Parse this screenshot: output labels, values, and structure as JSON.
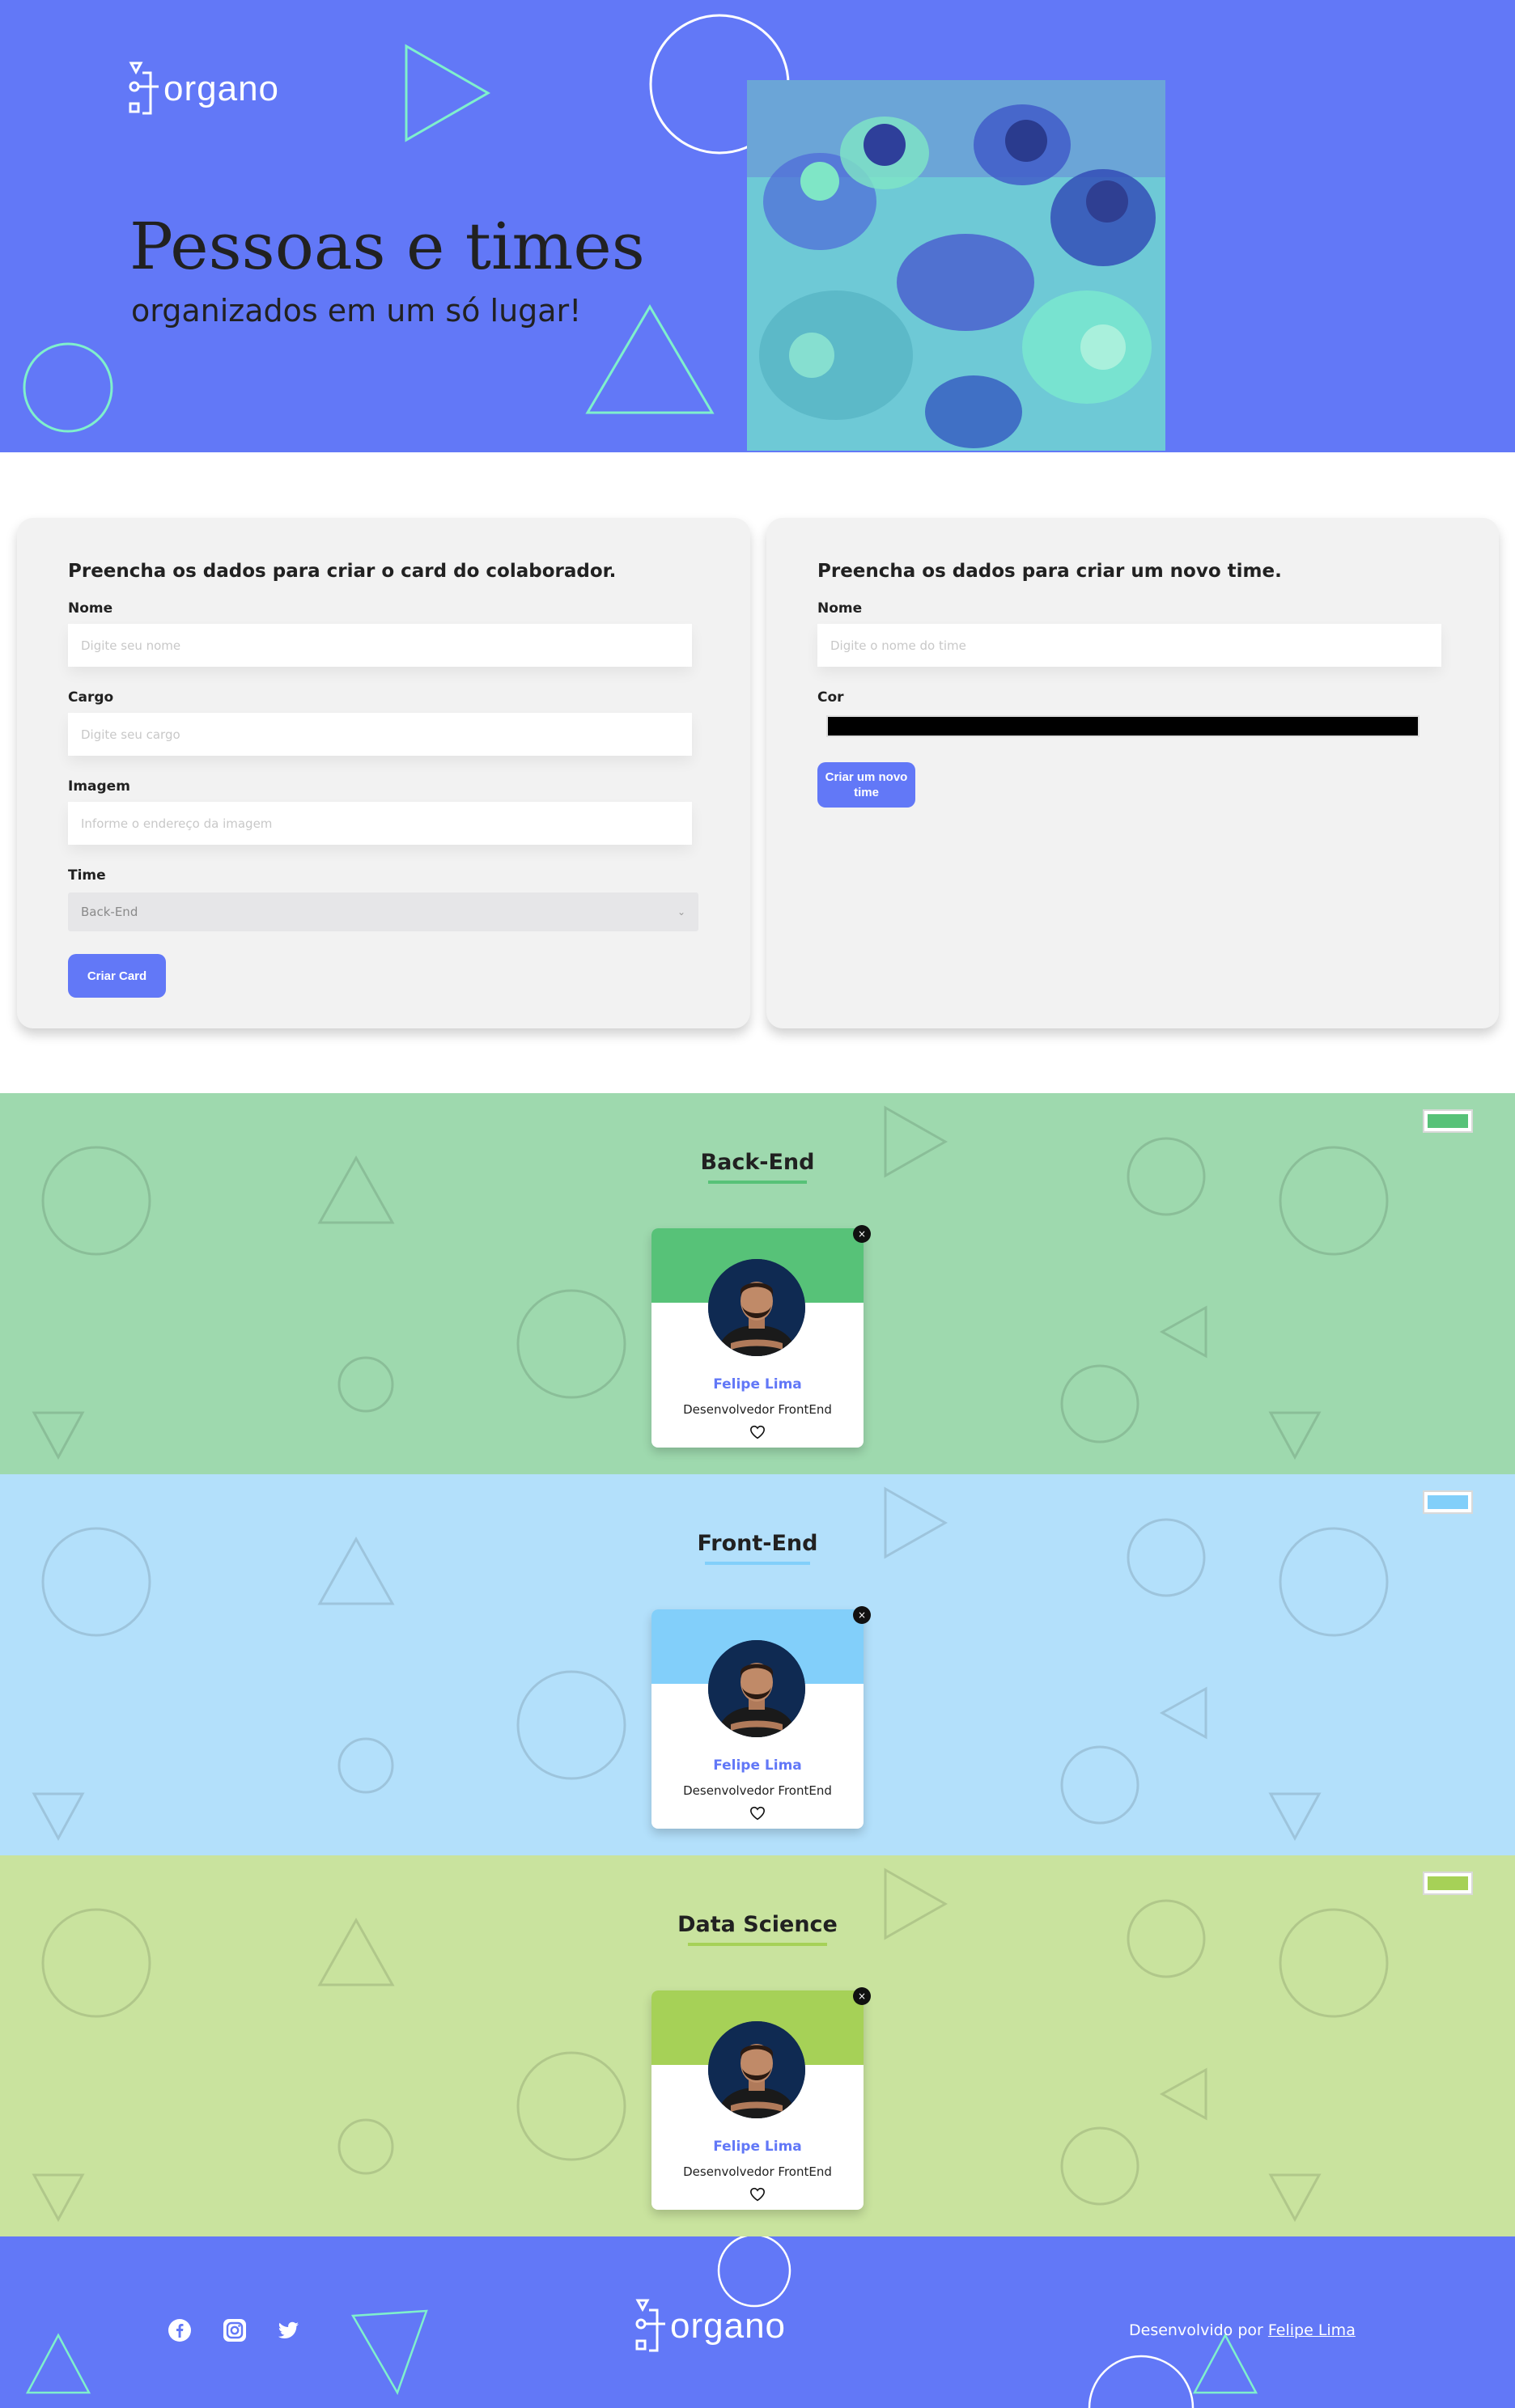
{
  "brand": {
    "name": "organo",
    "color": "#6278f7"
  },
  "hero": {
    "title": "Pessoas e times",
    "subtitle": "organizados em um só lugar!",
    "photo_icon": "team-hands-photo"
  },
  "collaborator_form": {
    "heading": "Preencha os dados para criar o card do colaborador.",
    "name_label": "Nome",
    "name_placeholder": "Digite seu nome",
    "role_label": "Cargo",
    "role_placeholder": "Digite seu cargo",
    "image_label": "Imagem",
    "image_placeholder": "Informe o endereço da imagem",
    "team_label": "Time",
    "team_selected": "Back-End",
    "submit_label": "Criar Card"
  },
  "team_form": {
    "heading": "Preencha os dados para criar um novo time.",
    "name_label": "Nome",
    "name_placeholder": "Digite o nome do time",
    "color_label": "Cor",
    "color_value": "#000000",
    "submit_label": "Criar um novo time"
  },
  "teams": [
    {
      "name": "Back-End",
      "primary_color": "#57c278",
      "background_color": "#9ed9ae",
      "members": [
        {
          "name": "Felipe Lima",
          "role": "Desenvolvedor FrontEnd"
        }
      ]
    },
    {
      "name": "Front-End",
      "primary_color": "#82cffa",
      "background_color": "#b3e0fb",
      "members": [
        {
          "name": "Felipe Lima",
          "role": "Desenvolvedor FrontEnd"
        }
      ]
    },
    {
      "name": "Data Science",
      "primary_color": "#a6d157",
      "background_color": "#c9e39e",
      "members": [
        {
          "name": "Felipe Lima",
          "role": "Desenvolvedor FrontEnd"
        }
      ]
    }
  ],
  "card_actions": {
    "delete_glyph": "×",
    "favorite_icon": "heart-icon"
  },
  "footer": {
    "social_icons": [
      "facebook-icon",
      "instagram-icon",
      "twitter-icon"
    ],
    "credit_prefix": "Desenvolvido por ",
    "credit_link": "Felipe Lima"
  }
}
